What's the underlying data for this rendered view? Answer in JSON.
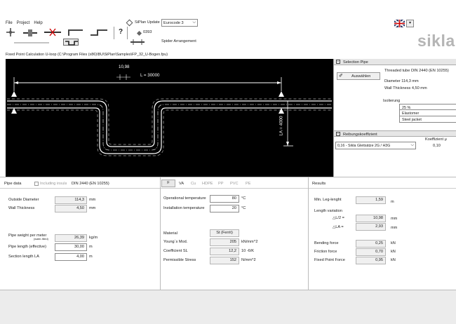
{
  "menu": [
    "File",
    "Project",
    "Help"
  ],
  "toolbar": {
    "update_label": "SiPlan Update",
    "code_select": "Eurocode 3",
    "version": "0393",
    "spider_label": "Spider Arrangement"
  },
  "brand": "sikla",
  "title_bar": "Fixed Point Calculation U-loop  (C:\\Program Files (x86)\\BU\\SiPlan\\Samples\\FP_32_U-Bogen.fpu)",
  "canvas": {
    "dim_top": "10,98",
    "dim_length": "L = 30000",
    "dim_la": "LA = 4000"
  },
  "selection_pipe": {
    "header": "Selection Pipe",
    "button": "Auswählen",
    "pipe_name": "Threaded tube DIN 2440 (EN 10255)",
    "diameter": "Diameter 114,3 mm",
    "wall": "Wall Thickness 4,50 mm",
    "insulation_label": "Isolierung",
    "insulation_rows": [
      "25 %",
      "Elastomer",
      "Steel jacket"
    ]
  },
  "friction": {
    "header": "Reibungskoeffizient",
    "select": "0,16 - Sikla Gleitsätze 2G / H3G",
    "coef_label": "Koeffizient μ",
    "coef_value": "0,10"
  },
  "pipe_data": {
    "title": "Pipe data",
    "checkbox_label": "Including insulation",
    "pipe_type": "DIN 2440 (EN 10255)",
    "outside_diameter": {
      "label": "Outside Diameter",
      "value": "114,3",
      "unit": "mm"
    },
    "wall_thickness": {
      "label": "Wall Thickness",
      "value": "4,50",
      "unit": "mm"
    },
    "weight": {
      "label": "Pipe weight per meter",
      "sub": "(water-filled)",
      "value": "26,39",
      "unit": "kg/m"
    },
    "length_eff": {
      "label": "Pipe length (effective)",
      "value": "30,00",
      "unit": "m"
    },
    "section_la": {
      "label": "Section length LA",
      "value": "4,00",
      "unit": "m"
    }
  },
  "material": {
    "tabs": [
      "F",
      "VA",
      "Cu",
      "HDPE",
      "PP",
      "PVC",
      "PE"
    ],
    "op_temp": {
      "label": "Operational temperature",
      "value": "80",
      "unit": "°C"
    },
    "inst_temp": {
      "label": "Installation temperature",
      "value": "20",
      "unit": "°C"
    },
    "material": {
      "label": "Material",
      "value": "St (Ferrit)"
    },
    "youngs": {
      "label": "Young´s Mod.",
      "value": "205",
      "unit": "kN/mm^2"
    },
    "coef_sl": {
      "label": "Coefficient SL",
      "value": "12,2",
      "unit": "10 -6/K"
    },
    "stress": {
      "label": "Permissible Stress",
      "value": "152",
      "unit": "N/mm^2"
    }
  },
  "results": {
    "title": "Results",
    "min_leg": {
      "label": "Min. Leg-lenght",
      "value": "1,59",
      "unit": "m"
    },
    "length_var": "Length variation",
    "dl2": {
      "label": "△L/2 =",
      "value": "10,98",
      "unit": "mm"
    },
    "dla": {
      "label": "△LA =",
      "value": "2,93",
      "unit": "mm"
    },
    "bending": {
      "label": "Bending force",
      "value": "0,25",
      "unit": "kN"
    },
    "friction": {
      "label": "Friction force",
      "value": "0,70",
      "unit": "kN"
    },
    "fixed": {
      "label": "Fixed Point Force",
      "value": "0,95",
      "unit": "kN"
    }
  }
}
